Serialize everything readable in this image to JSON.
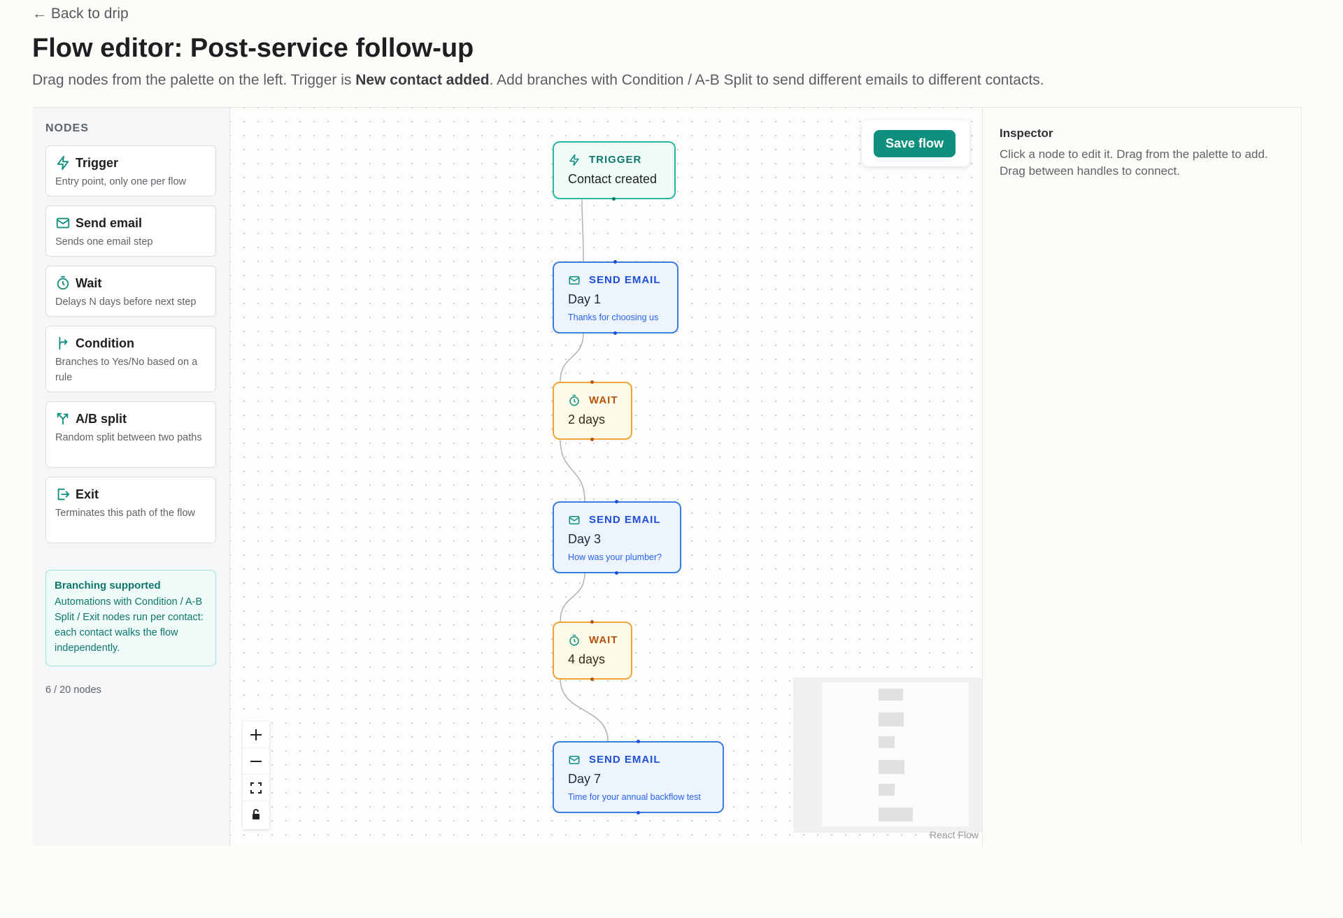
{
  "header": {
    "back_link": "← Back to drip",
    "title": "Flow editor: Post-service follow-up",
    "subtitle_pre": "Drag nodes from the palette on the left. Trigger is ",
    "subtitle_bold": "New contact added",
    "subtitle_post": ". Add branches with Condition / A-B Split to send different emails to different contacts."
  },
  "palette": {
    "heading": "NODES",
    "items": [
      {
        "title": "Trigger",
        "desc": "Entry point, only one per flow",
        "icon": "bolt-icon"
      },
      {
        "title": "Send email",
        "desc": "Sends one email step",
        "icon": "envelope-icon"
      },
      {
        "title": "Wait",
        "desc": "Delays N days before next step",
        "icon": "timer-icon"
      },
      {
        "title": "Condition",
        "desc": "Branches to Yes/No based on a rule",
        "icon": "branch-icon"
      },
      {
        "title": "A/B split",
        "desc": "Random split between two paths",
        "icon": "split-icon"
      },
      {
        "title": "Exit",
        "desc": "Terminates this path of the flow",
        "icon": "exit-icon"
      }
    ],
    "branch_note": {
      "title": "Branching supported",
      "body": "Automations with Condition / A-B Split / Exit nodes run per contact: each contact walks the flow independently."
    },
    "node_count": "6 / 20 nodes"
  },
  "canvas": {
    "save_label": "Save flow",
    "attribution": "React Flow",
    "nodes": [
      {
        "kind": "TRIGGER",
        "label": "Contact created",
        "sub": ""
      },
      {
        "kind": "SEND EMAIL",
        "label": "Day 1",
        "sub": "Thanks for choosing us"
      },
      {
        "kind": "WAIT",
        "label": "2 days",
        "sub": ""
      },
      {
        "kind": "SEND EMAIL",
        "label": "Day 3",
        "sub": "How was your plumber?"
      },
      {
        "kind": "WAIT",
        "label": "4 days",
        "sub": ""
      },
      {
        "kind": "SEND EMAIL",
        "label": "Day 7",
        "sub": "Time for your annual backflow test"
      }
    ]
  },
  "inspector": {
    "title": "Inspector",
    "body": "Click a node to edit it. Drag from the palette to add. Drag between handles to connect."
  },
  "colors": {
    "accent": "#0f8f7e",
    "trigger_border": "#27b7a2",
    "email_border": "#3c7de0",
    "wait_border": "#f0a436"
  }
}
